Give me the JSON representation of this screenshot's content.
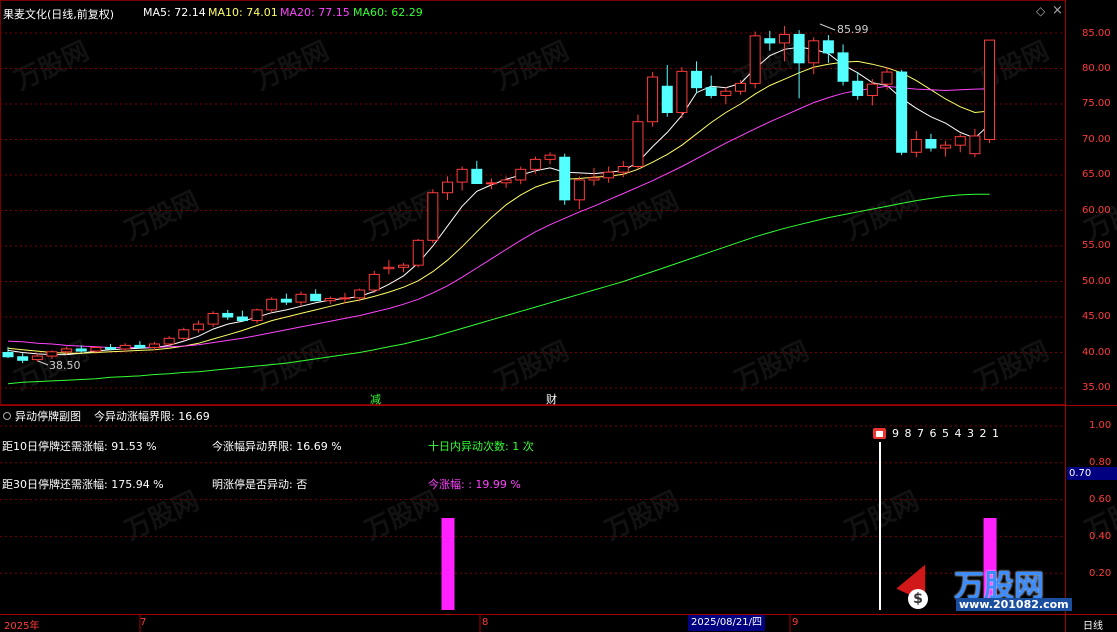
{
  "header": {
    "stock_title": "果麦文化(日线,前复权)",
    "ma_labels": [
      "MA5: 72.14",
      "MA10: 74.01",
      "MA20: 77.15",
      "MA60: 62.29"
    ],
    "ma_colors": [
      "#ffffff",
      "#ffff66",
      "#ff44ff",
      "#33ff33"
    ]
  },
  "window_icons": {
    "diamond": "◇",
    "close": "×"
  },
  "price_axis": [
    "85.00",
    "80.00",
    "75.00",
    "70.00",
    "65.00",
    "60.00",
    "55.00",
    "50.00",
    "45.00",
    "40.00",
    "35.00"
  ],
  "price_annotations": {
    "high": "85.99",
    "low": "38.50"
  },
  "event_markers": [
    "减",
    "财"
  ],
  "sub_panel": {
    "title": "异动停牌副图",
    "threshold_label": "今异动涨幅界限: 16.69",
    "lines": [
      {
        "text": "距10日停牌还需涨幅: 91.53 %",
        "color": "#ffffff"
      },
      {
        "text": "今涨幅异动界限: 16.69 %",
        "color": "#ffffff"
      },
      {
        "text": "十日内异动次数: 1 次",
        "color": "#33ff33"
      },
      {
        "text": "距30日停牌还需涨幅: 175.94 %",
        "color": "#ffffff"
      },
      {
        "text": "明涨停是否异动: 否",
        "color": "#ffffff"
      },
      {
        "text": "今涨幅: : 19.99 %",
        "color": "#ff44ff"
      }
    ],
    "countdown": "9 8 7 6 5 4 3 2 1",
    "axis": [
      "1.00",
      "0.80",
      "0.60",
      "0.40",
      "0.20"
    ],
    "current_value": "0.70"
  },
  "bottom_axis": {
    "year": "2025年",
    "months": [
      "7",
      "8",
      "9"
    ],
    "cursor_date": "2025/08/21/四",
    "period": "日线"
  },
  "watermark": {
    "logo_text": "万股网",
    "site": "www.201082.com"
  },
  "chart_data": {
    "type": "candlestick",
    "ylim": [
      33,
      87
    ],
    "candles": [
      [
        40.0,
        40.8,
        39.2,
        39.4
      ],
      [
        39.4,
        39.9,
        38.5,
        38.9
      ],
      [
        39.0,
        39.8,
        38.7,
        39.5
      ],
      [
        39.5,
        40.3,
        39.1,
        40.1
      ],
      [
        40.1,
        40.8,
        39.7,
        40.5
      ],
      [
        40.5,
        41.0,
        40.0,
        40.2
      ],
      [
        40.2,
        40.9,
        39.8,
        40.7
      ],
      [
        40.7,
        41.2,
        40.3,
        40.5
      ],
      [
        40.5,
        41.3,
        40.1,
        41.0
      ],
      [
        41.0,
        41.6,
        40.6,
        40.7
      ],
      [
        40.7,
        41.5,
        40.3,
        41.2
      ],
      [
        41.2,
        42.3,
        40.9,
        42.0
      ],
      [
        42.0,
        43.5,
        41.6,
        43.2
      ],
      [
        43.2,
        44.5,
        42.8,
        44.0
      ],
      [
        44.0,
        45.8,
        43.6,
        45.5
      ],
      [
        45.5,
        46.0,
        44.6,
        45.0
      ],
      [
        45.0,
        45.9,
        44.4,
        44.5
      ],
      [
        44.5,
        46.2,
        44.1,
        46.0
      ],
      [
        46.0,
        47.8,
        45.6,
        47.5
      ],
      [
        47.5,
        48.3,
        46.7,
        47.1
      ],
      [
        47.1,
        48.6,
        46.6,
        48.2
      ],
      [
        48.2,
        48.9,
        47.2,
        47.3
      ],
      [
        47.3,
        47.9,
        46.8,
        47.6
      ],
      [
        47.6,
        48.4,
        46.9,
        47.7
      ],
      [
        47.7,
        49.0,
        47.2,
        48.8
      ],
      [
        48.8,
        51.5,
        48.4,
        51.0
      ],
      [
        51.8,
        53.0,
        51.0,
        52.0
      ],
      [
        52.0,
        52.6,
        51.3,
        52.3
      ],
      [
        52.3,
        56.0,
        52.0,
        55.8
      ],
      [
        55.8,
        63.0,
        55.4,
        62.5
      ],
      [
        62.5,
        64.8,
        61.5,
        64.0
      ],
      [
        64.0,
        66.2,
        62.8,
        65.8
      ],
      [
        65.8,
        67.0,
        64.5,
        63.8
      ],
      [
        63.8,
        64.5,
        63.0,
        63.9
      ],
      [
        63.9,
        64.8,
        63.2,
        64.3
      ],
      [
        64.3,
        66.2,
        63.7,
        65.8
      ],
      [
        65.8,
        67.6,
        65.2,
        67.2
      ],
      [
        67.2,
        68.2,
        66.5,
        67.8
      ],
      [
        67.5,
        68.0,
        60.8,
        61.5
      ],
      [
        61.5,
        64.8,
        60.2,
        64.3
      ],
      [
        64.3,
        66.0,
        63.5,
        64.6
      ],
      [
        64.6,
        66.2,
        63.9,
        65.4
      ],
      [
        65.4,
        67.0,
        64.7,
        66.2
      ],
      [
        66.2,
        73.5,
        65.8,
        72.5
      ],
      [
        72.5,
        79.5,
        71.8,
        78.8
      ],
      [
        77.5,
        80.5,
        73.2,
        73.8
      ],
      [
        73.8,
        80.2,
        73.0,
        79.6
      ],
      [
        79.6,
        81.0,
        76.5,
        77.3
      ],
      [
        77.3,
        79.0,
        75.8,
        76.2
      ],
      [
        76.2,
        77.4,
        75.0,
        76.8
      ],
      [
        76.8,
        78.4,
        76.3,
        77.9
      ],
      [
        77.9,
        85.2,
        77.2,
        84.6
      ],
      [
        84.2,
        85.3,
        82.5,
        83.6
      ],
      [
        83.6,
        85.99,
        81.0,
        84.8
      ],
      [
        84.8,
        85.4,
        75.8,
        80.8
      ],
      [
        80.8,
        84.4,
        79.2,
        83.9
      ],
      [
        83.9,
        84.7,
        80.8,
        82.2
      ],
      [
        82.2,
        83.4,
        77.6,
        78.2
      ],
      [
        78.2,
        79.5,
        75.6,
        76.2
      ],
      [
        76.2,
        78.5,
        74.8,
        77.8
      ],
      [
        77.8,
        80.2,
        77.0,
        79.5
      ],
      [
        79.5,
        79.8,
        67.8,
        68.2
      ],
      [
        68.2,
        71.2,
        67.5,
        70.0
      ],
      [
        70.0,
        70.8,
        68.3,
        68.8
      ],
      [
        68.8,
        69.8,
        67.6,
        69.2
      ],
      [
        69.2,
        70.8,
        68.2,
        70.4
      ],
      [
        68.0,
        71.5,
        67.5,
        70.5
      ],
      [
        70.0,
        84.0,
        69.5,
        84.0
      ]
    ],
    "ma_lines": {
      "MA5": [
        40.3,
        40.0,
        39.8,
        39.7,
        39.7,
        39.9,
        40.2,
        40.4,
        40.5,
        40.6,
        40.7,
        41.0,
        41.6,
        42.3,
        43.3,
        44.0,
        44.4,
        45.0,
        45.6,
        46.0,
        46.5,
        47.0,
        47.4,
        47.6,
        47.9,
        48.6,
        49.6,
        50.8,
        52.6,
        55.0,
        57.8,
        60.6,
        62.7,
        63.6,
        64.4,
        65.0,
        65.6,
        66.0,
        65.4,
        65.3,
        65.2,
        65.4,
        65.6,
        66.8,
        69.0,
        71.0,
        73.4,
        76.6,
        77.5,
        77.3,
        77.9,
        80.0,
        81.8,
        82.7,
        83.0,
        82.7,
        82.1,
        80.5,
        79.4,
        78.0,
        77.6,
        75.8,
        74.4,
        73.2,
        72.3,
        71.0,
        70.2,
        72.14
      ],
      "MA10": [
        40.6,
        40.4,
        40.2,
        40.0,
        39.9,
        39.9,
        40.0,
        40.1,
        40.2,
        40.3,
        40.4,
        40.6,
        40.9,
        41.3,
        41.9,
        42.5,
        43.1,
        43.8,
        44.5,
        45.0,
        45.5,
        46.0,
        46.5,
        47.0,
        47.4,
        47.9,
        48.5,
        49.2,
        50.1,
        51.4,
        53.0,
        54.9,
        57.0,
        59.0,
        60.8,
        62.2,
        63.3,
        64.0,
        64.4,
        64.5,
        64.7,
        64.8,
        65.1,
        65.8,
        66.8,
        67.9,
        69.2,
        70.8,
        72.4,
        73.8,
        75.0,
        76.4,
        77.6,
        78.5,
        79.4,
        80.2,
        80.6,
        80.9,
        81.0,
        80.6,
        80.1,
        79.4,
        78.3,
        77.0,
        75.7,
        74.6,
        73.8,
        74.01
      ],
      "MA20": [
        41.6,
        41.5,
        41.3,
        41.2,
        41.0,
        40.9,
        40.8,
        40.7,
        40.7,
        40.7,
        40.7,
        40.8,
        40.9,
        41.1,
        41.4,
        41.7,
        42.0,
        42.4,
        42.8,
        43.2,
        43.6,
        44.0,
        44.4,
        44.8,
        45.2,
        45.7,
        46.2,
        46.8,
        47.5,
        48.4,
        49.4,
        50.6,
        51.9,
        53.2,
        54.5,
        55.8,
        57.0,
        58.0,
        58.9,
        59.8,
        60.6,
        61.5,
        62.4,
        63.3,
        64.2,
        65.2,
        66.2,
        67.3,
        68.4,
        69.5,
        70.5,
        71.5,
        72.5,
        73.4,
        74.3,
        75.2,
        75.9,
        76.5,
        76.9,
        77.2,
        77.5,
        77.3,
        77.1,
        77.0,
        76.9,
        77.0,
        77.1,
        77.15
      ],
      "MA60": [
        35.6,
        35.8,
        35.9,
        36.0,
        36.1,
        36.2,
        36.3,
        36.5,
        36.6,
        36.7,
        36.9,
        37.0,
        37.2,
        37.3,
        37.5,
        37.7,
        37.9,
        38.1,
        38.3,
        38.5,
        38.8,
        39.1,
        39.4,
        39.7,
        40.0,
        40.4,
        40.8,
        41.2,
        41.7,
        42.2,
        42.8,
        43.4,
        44.0,
        44.6,
        45.2,
        45.8,
        46.4,
        47.0,
        47.6,
        48.2,
        48.8,
        49.4,
        50.0,
        50.7,
        51.4,
        52.1,
        52.8,
        53.5,
        54.2,
        54.9,
        55.6,
        56.3,
        56.9,
        57.5,
        58.0,
        58.5,
        59.0,
        59.4,
        59.8,
        60.2,
        60.6,
        61.0,
        61.4,
        61.7,
        62.0,
        62.2,
        62.3,
        62.29
      ]
    },
    "sub_bars": [
      {
        "index": 30,
        "value": 0.5
      },
      {
        "index": 67,
        "value": 0.5
      }
    ],
    "sub_ylim": [
      0,
      1.1
    ]
  }
}
